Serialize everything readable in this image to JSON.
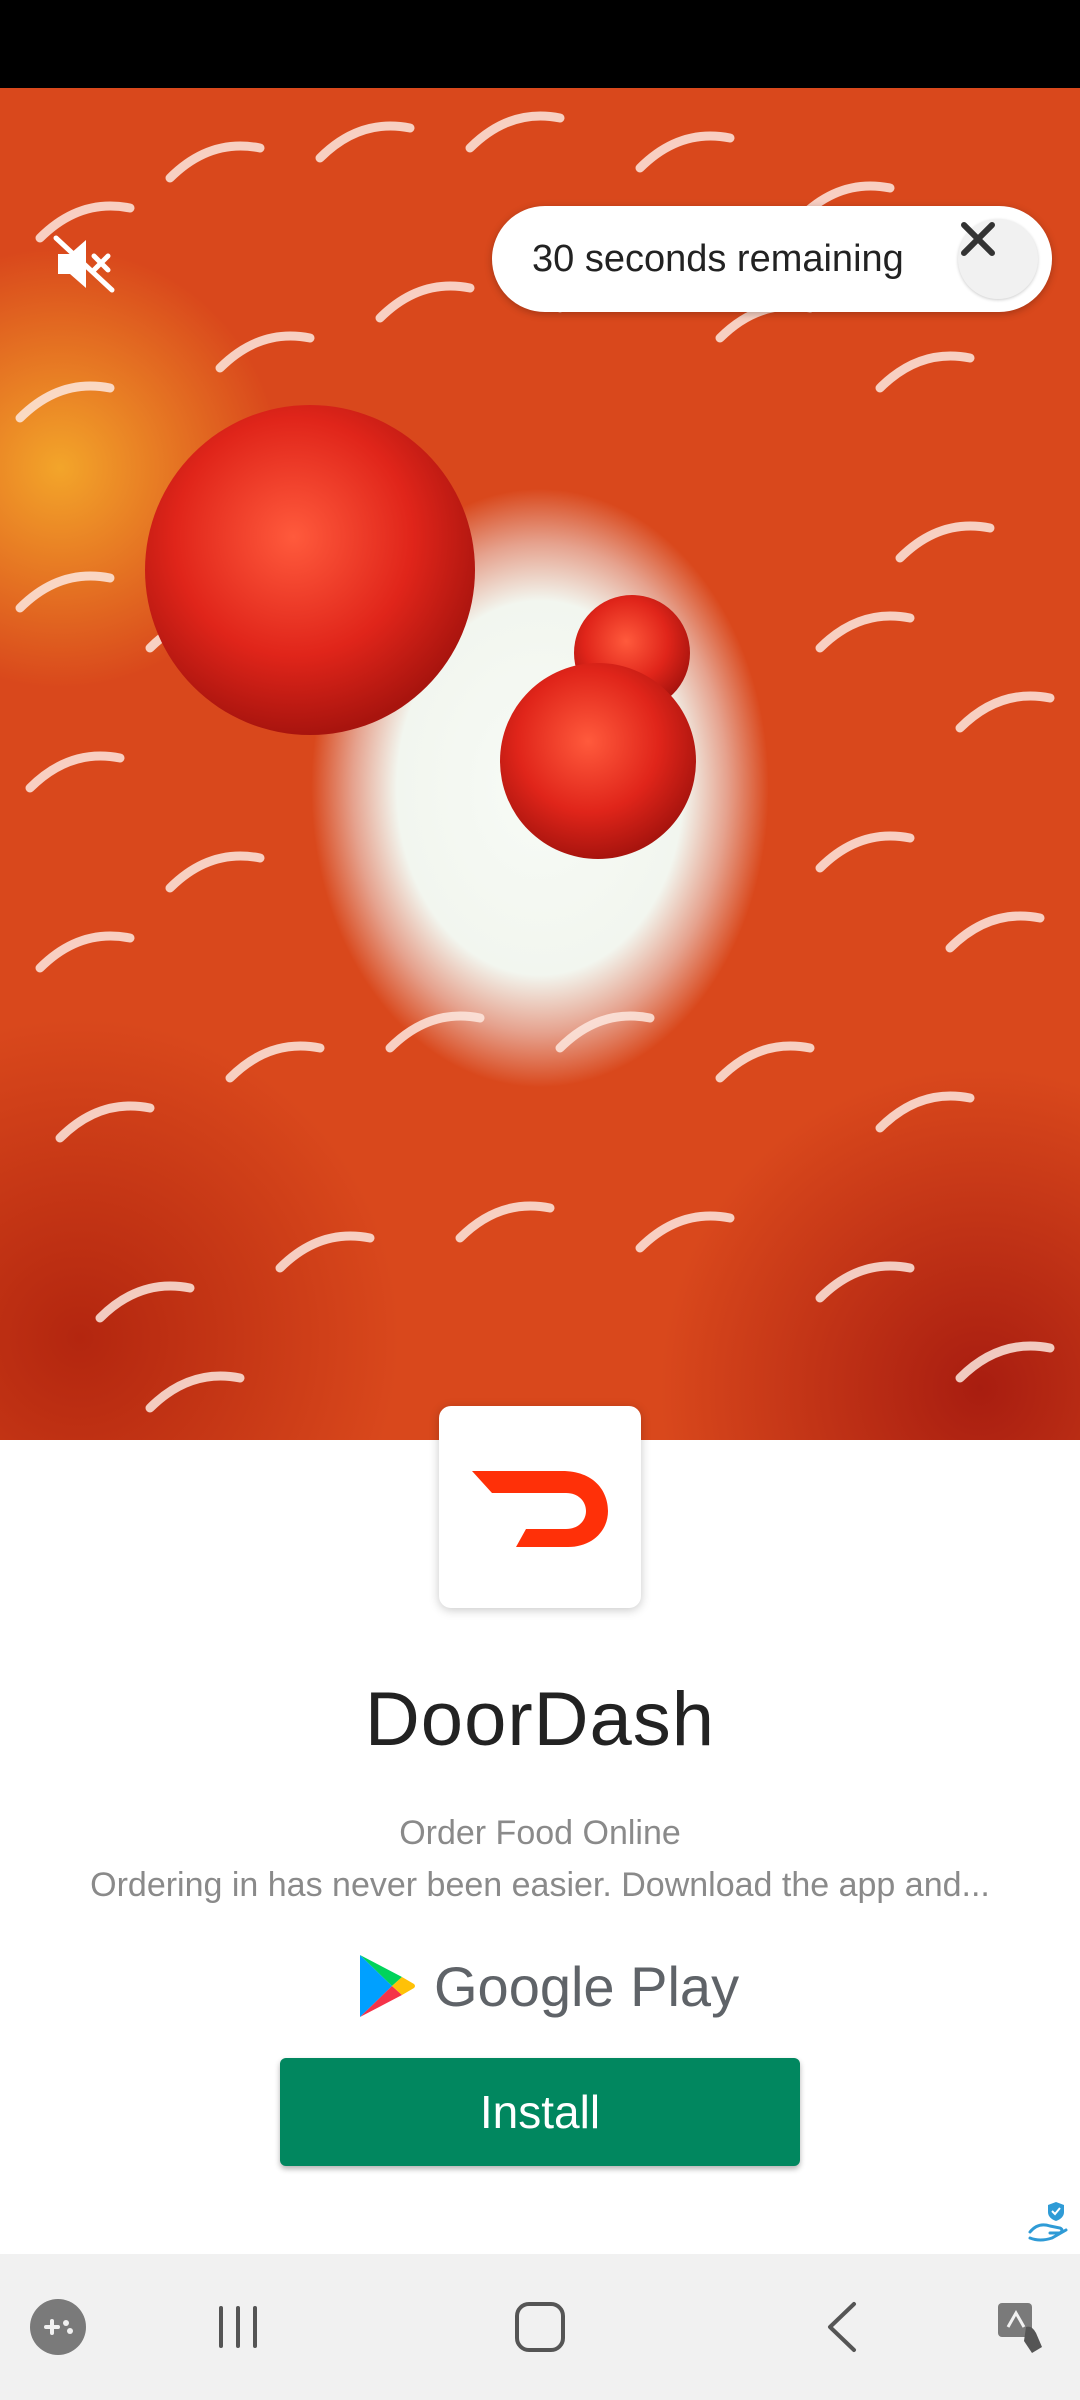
{
  "ad": {
    "timer_text": "30 seconds remaining",
    "app_name": "DoorDash",
    "tagline": "Order Food Online",
    "description": "Ordering in has never been easier. Download the app and...",
    "store_name": "Google Play",
    "install_label": "Install"
  },
  "icons": {
    "mute": "speaker-muted-icon",
    "close": "close-icon",
    "app_logo": "doordash-logo-icon",
    "store_logo": "google-play-icon",
    "adchoices": "adchoices-icon"
  },
  "nav": {
    "items": [
      "game-launcher-icon",
      "recent-apps-icon",
      "home-icon",
      "back-icon",
      "accessibility-icon"
    ]
  },
  "colors": {
    "brand": "#ff3008",
    "install": "#01875f",
    "video_base": "#d9481c"
  }
}
